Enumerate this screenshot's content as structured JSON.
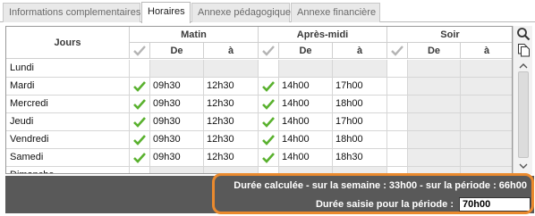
{
  "tabs": [
    {
      "label": "Informations complementaires",
      "active": false
    },
    {
      "label": "Horaires",
      "active": true
    },
    {
      "label": "Annexe pédagogique",
      "active": false
    },
    {
      "label": "Annexe financière",
      "active": false
    }
  ],
  "grid": {
    "header_jours": "Jours",
    "groups": [
      "Matin",
      "Après-midi",
      "Soir"
    ],
    "sub_de": "De",
    "sub_a": "à",
    "rows": [
      {
        "day": "Lundi",
        "matin_checked": false,
        "matin_de": "",
        "matin_a": "",
        "am_checked": false,
        "am_de": "",
        "am_a": ""
      },
      {
        "day": "Mardi",
        "matin_checked": true,
        "matin_de": "09h30",
        "matin_a": "12h30",
        "am_checked": true,
        "am_de": "14h00",
        "am_a": "17h00"
      },
      {
        "day": "Mercredi",
        "matin_checked": true,
        "matin_de": "09h30",
        "matin_a": "12h30",
        "am_checked": true,
        "am_de": "14h00",
        "am_a": "18h00"
      },
      {
        "day": "Jeudi",
        "matin_checked": true,
        "matin_de": "09h30",
        "matin_a": "12h30",
        "am_checked": true,
        "am_de": "14h00",
        "am_a": "17h00"
      },
      {
        "day": "Vendredi",
        "matin_checked": true,
        "matin_de": "09h30",
        "matin_a": "12h30",
        "am_checked": true,
        "am_de": "14h00",
        "am_a": "18h00"
      },
      {
        "day": "Samedi",
        "matin_checked": true,
        "matin_de": "09h30",
        "matin_a": "12h30",
        "am_checked": true,
        "am_de": "14h00",
        "am_a": "18h30"
      },
      {
        "day": "Dimanche",
        "matin_checked": false,
        "matin_de": "",
        "matin_a": "",
        "am_checked": false,
        "am_de": "",
        "am_a": ""
      }
    ]
  },
  "footer": {
    "calculated_label": "Durée calculée - sur la semaine : 33h00 - sur la période : 66h00",
    "entered_label": "Durée saisie pour la période :",
    "entered_value": "70h00"
  },
  "colors": {
    "check_green": "#59b12e",
    "footer_bg": "#595959",
    "highlight_orange": "#ea8a2e"
  },
  "icons": {
    "side_top": "search-icon",
    "side_second": "copy-document-icon",
    "header_check": "checkmark-icon",
    "scroll_up": "arrow-up-icon",
    "scroll_down": "arrow-down-icon"
  }
}
